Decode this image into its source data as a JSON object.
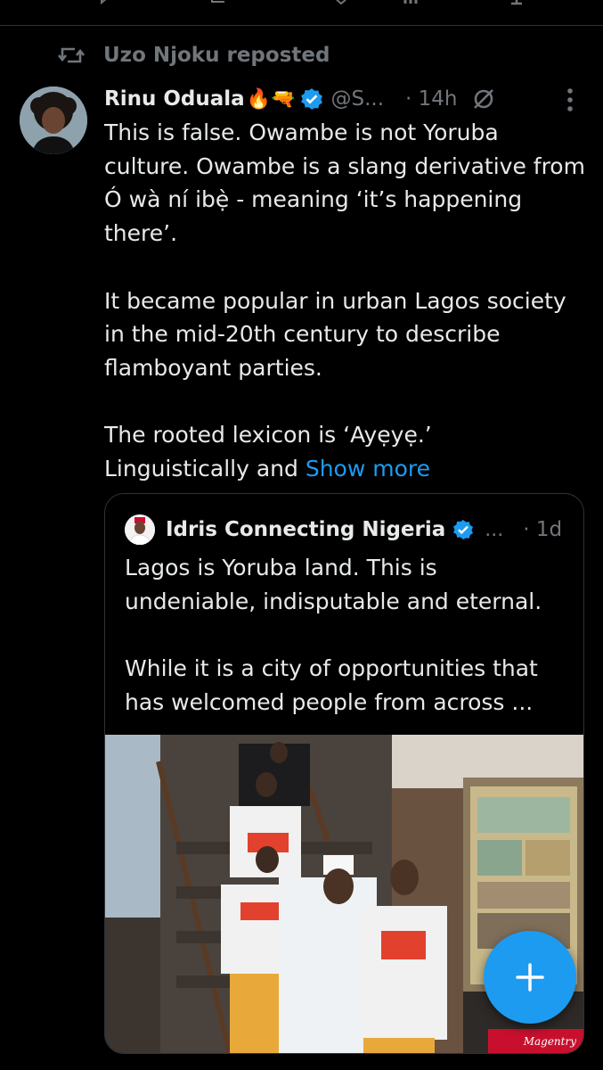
{
  "repost": {
    "text": "Uzo Njoku reposted"
  },
  "tweet": {
    "author_name": "Rinu Oduala",
    "emojis": "🔥🔫",
    "handle": "@S...",
    "time": "· 14h",
    "text": "This is false. Owambe is not Yoruba culture. Owambe is a slang derivative from Ó wà ní ibẹ̀ - meaning ‘it’s happening there’.\n\nIt became popular in urban Lagos society in the mid-20th century to describe flamboyant parties.\n\nThe rooted lexicon is ‘Ayẹyẹ.’\nLinguistically and ",
    "show_more": "Show more"
  },
  "quoted": {
    "author_name": "Idris Connecting Nigeria",
    "handle": "...",
    "time": "· 1d",
    "text": "Lagos is Yoruba land. This is undeniable, indisputable and eternal.\n\nWhile it is a city of opportunities that has welcomed people from across ...",
    "media": {
      "watermark": "Magentry"
    }
  },
  "colors": {
    "accent": "#1d9bf0",
    "muted": "#71767b",
    "text": "#e7e9ea",
    "background": "#000000",
    "border": "#2f3336"
  },
  "icons": {
    "repost": "repost-icon",
    "verified": "verified-badge-icon",
    "grok": "grok-icon",
    "more": "more-vertical-icon",
    "compose": "plus-icon"
  }
}
